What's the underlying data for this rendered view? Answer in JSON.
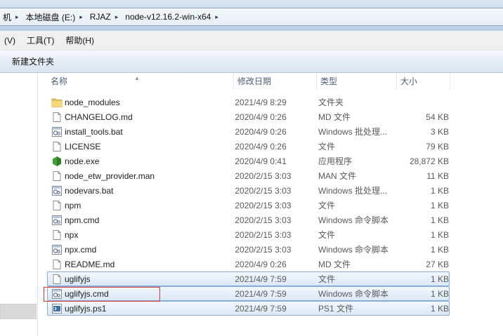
{
  "address": {
    "crumbs": [
      {
        "label": "机",
        "sep": "▸"
      },
      {
        "label": "本地磁盘 (E:)",
        "sep": "▸"
      },
      {
        "label": "RJAZ",
        "sep": "▸"
      },
      {
        "label": "node-v12.16.2-win-x64",
        "sep": "▸"
      }
    ]
  },
  "menu": {
    "items": [
      {
        "label": "(V)"
      },
      {
        "label": "工具(T)"
      },
      {
        "label": "帮助(H)"
      }
    ]
  },
  "toolbar": {
    "new_folder_label": "新建文件夹"
  },
  "columns": {
    "name": "名称",
    "date": "修改日期",
    "type": "类型",
    "size": "大小",
    "sort_indicator": "▲"
  },
  "files": [
    {
      "name": "node_modules",
      "date": "2021/4/9 8:29",
      "type": "文件夹",
      "size": "",
      "icon": "folder-icon",
      "selected": false
    },
    {
      "name": "CHANGELOG.md",
      "date": "2020/4/9 0:26",
      "type": "MD 文件",
      "size": "54 KB",
      "icon": "file-icon",
      "selected": false
    },
    {
      "name": "install_tools.bat",
      "date": "2020/4/9 0:26",
      "type": "Windows 批处理...",
      "size": "3 KB",
      "icon": "script-icon",
      "selected": false
    },
    {
      "name": "LICENSE",
      "date": "2020/4/9 0:26",
      "type": "文件",
      "size": "79 KB",
      "icon": "file-icon",
      "selected": false
    },
    {
      "name": "node.exe",
      "date": "2020/4/9 0:41",
      "type": "应用程序",
      "size": "28,872 KB",
      "icon": "node-icon",
      "selected": false
    },
    {
      "name": "node_etw_provider.man",
      "date": "2020/2/15 3:03",
      "type": "MAN 文件",
      "size": "11 KB",
      "icon": "file-icon",
      "selected": false
    },
    {
      "name": "nodevars.bat",
      "date": "2020/2/15 3:03",
      "type": "Windows 批处理...",
      "size": "1 KB",
      "icon": "script-icon",
      "selected": false
    },
    {
      "name": "npm",
      "date": "2020/2/15 3:03",
      "type": "文件",
      "size": "1 KB",
      "icon": "file-icon",
      "selected": false
    },
    {
      "name": "npm.cmd",
      "date": "2020/2/15 3:03",
      "type": "Windows 命令脚本",
      "size": "1 KB",
      "icon": "script-icon",
      "selected": false
    },
    {
      "name": "npx",
      "date": "2020/2/15 3:03",
      "type": "文件",
      "size": "1 KB",
      "icon": "file-icon",
      "selected": false
    },
    {
      "name": "npx.cmd",
      "date": "2020/2/15 3:03",
      "type": "Windows 命令脚本",
      "size": "1 KB",
      "icon": "script-icon",
      "selected": false
    },
    {
      "name": "README.md",
      "date": "2020/4/9 0:26",
      "type": "MD 文件",
      "size": "27 KB",
      "icon": "file-icon",
      "selected": false
    },
    {
      "name": "uglifyjs",
      "date": "2021/4/9 7:59",
      "type": "文件",
      "size": "1 KB",
      "icon": "file-icon",
      "selected": true
    },
    {
      "name": "uglifyjs.cmd",
      "date": "2021/4/9 7:59",
      "type": "Windows 命令脚本",
      "size": "1 KB",
      "icon": "script-icon",
      "selected": true
    },
    {
      "name": "uglifyjs.ps1",
      "date": "2021/4/9 7:59",
      "type": "PS1 文件",
      "size": "1 KB",
      "icon": "ps-script-icon",
      "selected": true
    }
  ],
  "colors": {
    "selection_border": "#84acdd",
    "highlight_box": "#e0353a",
    "node_green": "#3f9f33"
  }
}
